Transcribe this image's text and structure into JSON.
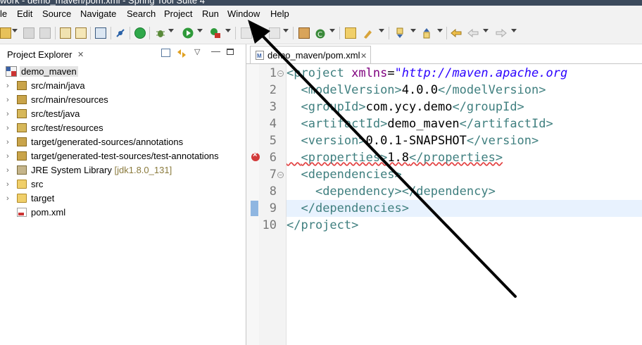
{
  "window": {
    "title": "work - demo_maven/pom.xml - Spring Tool Suite 4"
  },
  "menu": [
    "le",
    "Edit",
    "Source",
    "Navigate",
    "Search",
    "Project",
    "Run",
    "Window",
    "Help"
  ],
  "explorer": {
    "title": "Project Explorer",
    "project": "demo_maven",
    "items": [
      {
        "label": "src/main/java",
        "decoration": ""
      },
      {
        "label": "src/main/resources",
        "decoration": ""
      },
      {
        "label": "src/test/java",
        "decoration": ""
      },
      {
        "label": "src/test/resources",
        "decoration": ""
      },
      {
        "label": "target/generated-sources/annotations",
        "decoration": ""
      },
      {
        "label": "target/generated-test-sources/test-annotations",
        "decoration": ""
      },
      {
        "label": "JRE System Library",
        "decoration": "[jdk1.8.0_131]"
      },
      {
        "label": "src",
        "decoration": ""
      },
      {
        "label": "target",
        "decoration": ""
      },
      {
        "label": "pom.xml",
        "decoration": ""
      }
    ]
  },
  "editor": {
    "tab": "demo_maven/pom.xml",
    "line_numbers": [
      "1",
      "2",
      "3",
      "4",
      "5",
      "6",
      "7",
      "8",
      "9",
      "10"
    ],
    "lines": {
      "l1_open": "<project",
      "l1_attr": " xmlns",
      "l1_eq": "=",
      "l1_str": "\"http://maven.apache.org",
      "l2_open": "<modelVersion>",
      "l2_val": "4.0.0",
      "l2_close": "</modelVersion>",
      "l3_open": "<groupId>",
      "l3_val": "com.ycy.demo",
      "l3_close": "</groupId>",
      "l4_open": "<artifactId>",
      "l4_val": "demo_maven",
      "l4_close": "</artifactId>",
      "l5_open": "<version>",
      "l5_val": "0.0.1-SNAPSHOT",
      "l5_close": "</version>",
      "l6_open": "<properties>",
      "l6_val": "1.8",
      "l6_close": "</properties>",
      "l7_open": "<dependencies>",
      "l8_open": "<dependency>",
      "l8_close": "</dependency>",
      "l9_close": "</dependencies>",
      "l10_close": "</project>"
    }
  },
  "colors": {
    "tag": "#3f7f7f",
    "attribute": "#7f007f",
    "string": "#2a00ff",
    "error": "#d23a3a",
    "current_line": "#e8f2fe"
  }
}
